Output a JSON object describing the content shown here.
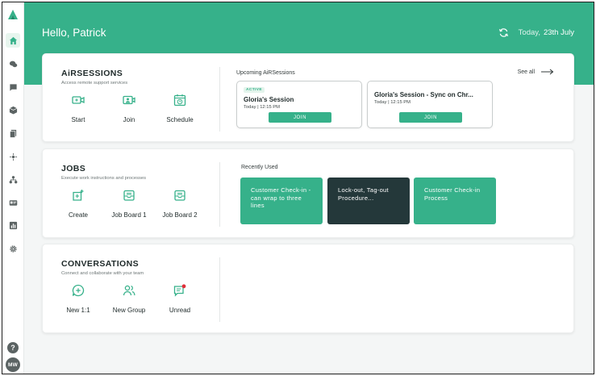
{
  "user": {
    "greeting": "Hello, Patrick",
    "initials": "MW"
  },
  "header": {
    "date_prefix": "Today,",
    "date": "23th July"
  },
  "sidebar": {
    "items": [
      {
        "icon": "home-icon",
        "active": true
      },
      {
        "icon": "chat-bubbles-icon"
      },
      {
        "icon": "message-icon"
      },
      {
        "icon": "box-icon"
      },
      {
        "icon": "copy-icon"
      },
      {
        "icon": "network-node-icon"
      },
      {
        "icon": "hierarchy-icon"
      },
      {
        "icon": "id-card-icon"
      },
      {
        "icon": "bar-chart-icon"
      },
      {
        "icon": "gear-icon"
      }
    ],
    "help_label": "?"
  },
  "airsessions": {
    "title": "AiRSESSIONS",
    "subtitle": "Access remote support services",
    "actions": [
      {
        "label": "Start",
        "icon": "video-icon"
      },
      {
        "label": "Join",
        "icon": "video-user-icon"
      },
      {
        "label": "Schedule",
        "icon": "calendar-clock-icon"
      }
    ],
    "upcoming_title": "Upcoming AiRSessions",
    "see_all": "See all",
    "sessions": [
      {
        "badge": "ACTIVE",
        "name": "Gloria's Session",
        "time": "Today | 12:15 PM",
        "join": "JOIN"
      },
      {
        "badge": "",
        "name": "Gloria's Session - Sync on Chr...",
        "time": "Today | 12:15 PM",
        "join": "JOIN"
      }
    ]
  },
  "jobs": {
    "title": "JOBS",
    "subtitle": "Execute work instructions and processes",
    "actions": [
      {
        "label": "Create",
        "icon": "create-job-icon"
      },
      {
        "label": "Job Board 1",
        "icon": "inbox-icon"
      },
      {
        "label": "Job Board 2",
        "icon": "inbox-icon"
      }
    ],
    "recent_title": "Recently Used",
    "recent": [
      {
        "text": "Customer Check-in - can wrap to three lines",
        "color": "#36b18a"
      },
      {
        "text": "Lock-out, Tag-out Procedure...",
        "color": "#24383a"
      },
      {
        "text": "Customer Check-in Process",
        "color": "#36b18a"
      }
    ]
  },
  "conversations": {
    "title": "CONVERSATIONS",
    "subtitle": "Connect and collaborate with your team",
    "actions": [
      {
        "label": "New 1:1",
        "icon": "chat-plus-icon"
      },
      {
        "label": "New Group",
        "icon": "group-icon"
      },
      {
        "label": "Unread",
        "icon": "unread-message-icon"
      }
    ]
  },
  "colors": {
    "accent": "#36b18a",
    "dark_tile": "#24383a",
    "unread_dot": "#e0303a"
  }
}
